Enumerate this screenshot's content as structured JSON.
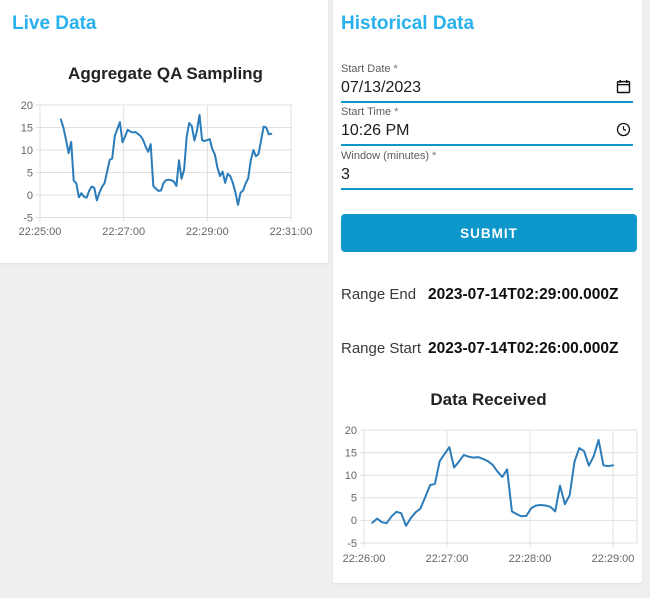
{
  "colors": {
    "accent_heading": "#29b1ee",
    "primary_blue": "#0d97cb",
    "grid": "#e0e0e0",
    "tick_text": "#666666",
    "line": "#2b7cb9",
    "page_bg": "#efefef",
    "card_bg": "#ffffff"
  },
  "live_panel": {
    "heading": "Live Data"
  },
  "historical_panel": {
    "heading": "Historical Data",
    "fields": [
      {
        "label": "Start Date",
        "required": "*",
        "value": "07/13/2023",
        "icon": "calendar-icon"
      },
      {
        "label": "Start Time",
        "required": "*",
        "value": "10:26 PM",
        "icon": "clock-icon"
      },
      {
        "label": "Window (minutes)",
        "required": "*",
        "value": "3",
        "icon": ""
      }
    ],
    "submit_label": "SUBMIT",
    "results": [
      {
        "label": "Range End",
        "value": "2023-07-14T02:29:00.000Z"
      },
      {
        "label": "Range Start",
        "value": "2023-07-14T02:26:00.000Z"
      }
    ]
  },
  "chart_data": [
    {
      "id": "live",
      "type": "line",
      "title": "Aggregate QA Sampling",
      "x_tick_labels": [
        "22:25:00",
        "22:27:00",
        "22:29:00",
        "22:31:00"
      ],
      "y_ticks": [
        20,
        15,
        10,
        5,
        0,
        -5
      ],
      "ylim": [
        -5,
        20
      ],
      "x_range_minutes": [
        0,
        6
      ],
      "data_start_min": 0.5,
      "data_end_min": 5.53,
      "grid": true,
      "legend": false,
      "line_color": "#2b7cb9",
      "values": [
        16.8,
        14.9,
        12.3,
        9.3,
        11.8,
        3.2,
        2.6,
        -0.5,
        0.4,
        -0.4,
        -0.6,
        0.9,
        1.9,
        1.6,
        -1.2,
        0.5,
        1.8,
        2.6,
        5.2,
        7.8,
        8.1,
        13.1,
        14.7,
        16.2,
        11.7,
        13.0,
        14.5,
        14.1,
        13.9,
        14.0,
        13.6,
        13.1,
        12.3,
        10.8,
        9.6,
        11.3,
        2.0,
        1.4,
        0.9,
        1.0,
        2.7,
        3.3,
        3.4,
        3.3,
        3.0,
        2.0,
        7.7,
        3.6,
        5.6,
        13.0,
        16.0,
        15.3,
        12.1,
        14.2,
        17.8,
        12.2,
        12.0,
        12.2,
        12.4,
        10.2,
        9.0,
        6.1,
        4.2,
        5.2,
        2.7,
        4.7,
        4.2,
        2.7,
        0.6,
        -2.2,
        0.5,
        1.0,
        2.6,
        3.7,
        7.7,
        10.0,
        8.6,
        9.1,
        12.1,
        15.2,
        15.0,
        13.5,
        13.6
      ]
    },
    {
      "id": "hist",
      "type": "line",
      "title": "Data Received",
      "x_tick_labels": [
        "22:26:00",
        "22:27:00",
        "22:28:00",
        "22:29:00"
      ],
      "y_ticks": [
        20,
        15,
        10,
        5,
        0,
        -5
      ],
      "ylim": [
        -5,
        20
      ],
      "x_range_minutes": [
        0,
        3
      ],
      "data_start_min": 0.1,
      "data_end_min": 3.0,
      "grid": true,
      "legend": false,
      "line_color": "#2b7cb9",
      "values": [
        -0.5,
        0.4,
        -0.4,
        -0.6,
        0.9,
        1.9,
        1.6,
        -1.2,
        0.5,
        1.8,
        2.6,
        5.2,
        7.8,
        8.1,
        13.1,
        14.7,
        16.2,
        11.7,
        13.0,
        14.5,
        14.1,
        13.9,
        14.0,
        13.6,
        13.1,
        12.3,
        10.8,
        9.6,
        11.3,
        2.0,
        1.4,
        0.9,
        1.0,
        2.7,
        3.3,
        3.4,
        3.3,
        3.0,
        2.0,
        7.7,
        3.6,
        5.6,
        13.0,
        16.0,
        15.3,
        12.1,
        14.2,
        17.8,
        12.2,
        12.0,
        12.2
      ]
    }
  ]
}
